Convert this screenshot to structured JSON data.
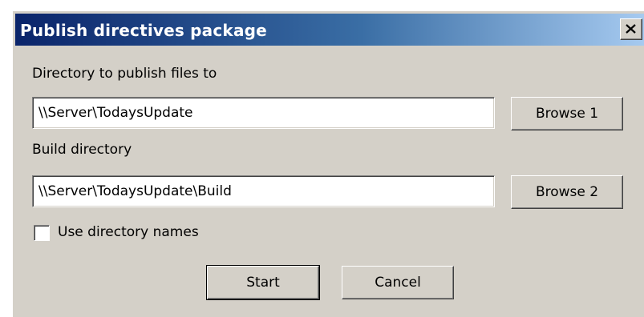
{
  "dialog": {
    "title": "Publish directives package",
    "close_symbol": "close-icon"
  },
  "publish": {
    "label": "Directory to publish files to",
    "value": "\\\\Server\\TodaysUpdate",
    "browse_label": "Browse 1"
  },
  "build": {
    "label": "Build directory",
    "value": "\\\\Server\\TodaysUpdate\\Build",
    "browse_label": "Browse 2"
  },
  "options": {
    "use_directory_names_label": "Use directory names",
    "use_directory_names_checked": false
  },
  "actions": {
    "start_label": "Start",
    "cancel_label": "Cancel"
  },
  "colors": {
    "face": "#d4d0c8",
    "title_start": "#0a246a",
    "title_end": "#a6caf0"
  }
}
